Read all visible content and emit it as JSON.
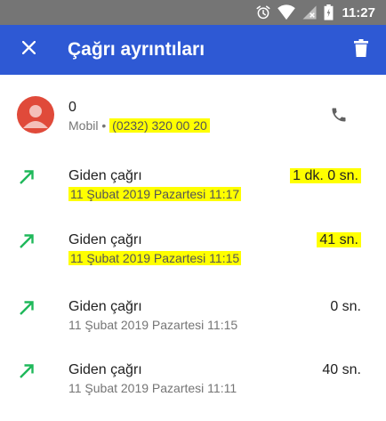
{
  "status_bar": {
    "time": "11:27",
    "icons": [
      "alarm-icon",
      "wifi-icon",
      "no-signal-icon",
      "battery-icon"
    ]
  },
  "app_bar": {
    "title": "Çağrı ayrıntıları",
    "color": "#2e59d4",
    "close_icon": "close-icon",
    "delete_icon": "trash-icon"
  },
  "contact": {
    "name": "0",
    "label": "Mobil",
    "separator": " • ",
    "number": "(0232) 320 00 20",
    "avatar_color": "#e04a3a"
  },
  "calls": [
    {
      "type": "Giden çağrı",
      "date": "11 Şubat 2019 Pazartesi 11:17",
      "duration": "1 dk. 0 sn.",
      "highlighted": true
    },
    {
      "type": "Giden çağrı",
      "date": "11 Şubat 2019 Pazartesi 11:15",
      "duration": "41 sn.",
      "highlighted": true
    },
    {
      "type": "Giden çağrı",
      "date": "11 Şubat 2019 Pazartesi 11:15",
      "duration": "0 sn.",
      "highlighted": false
    },
    {
      "type": "Giden çağrı",
      "date": "11 Şubat 2019 Pazartesi 11:11",
      "duration": "40 sn.",
      "highlighted": false
    }
  ],
  "colors": {
    "outgoing_arrow": "#1fb85a",
    "highlight": "#ffff00"
  }
}
